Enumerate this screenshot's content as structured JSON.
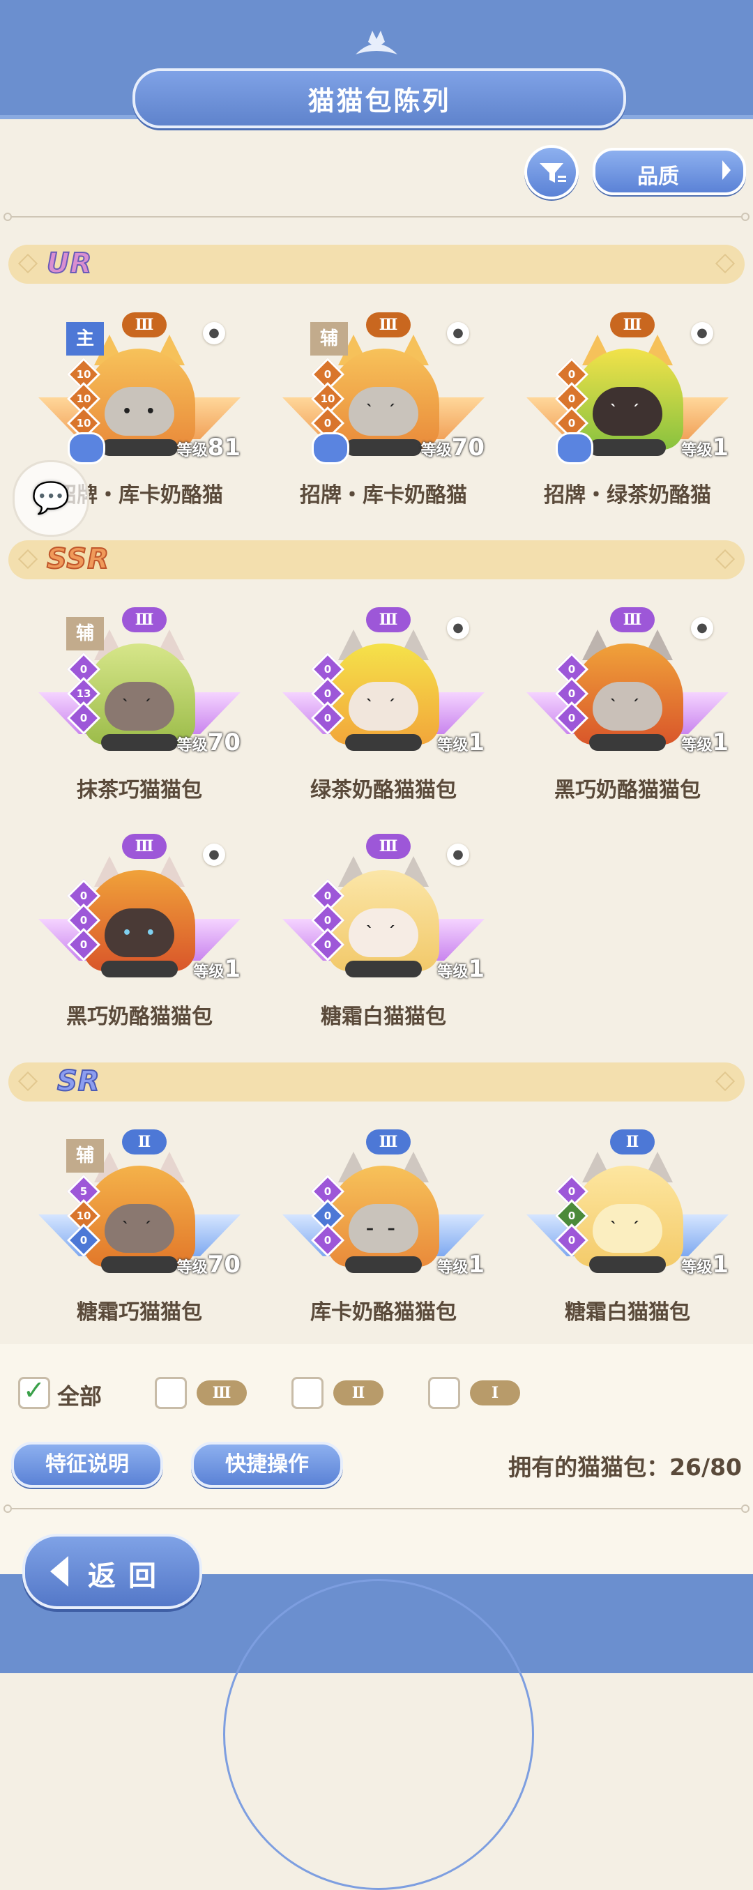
{
  "title": "猫猫包陈列",
  "filter_label": "",
  "quality_label": "品质",
  "sections": [
    {
      "tag": "UR",
      "cards": [
        {
          "role": "主",
          "grade": "Ⅲ",
          "stats": [
            "10",
            "10",
            "10"
          ],
          "level_label": "等级",
          "level": "81",
          "name": "招牌・库卡奶酪猫"
        },
        {
          "role": "辅",
          "grade": "Ⅲ",
          "stats": [
            "0",
            "10",
            "0"
          ],
          "level_label": "等级",
          "level": "70",
          "name": "招牌・库卡奶酪猫"
        },
        {
          "role": "",
          "grade": "Ⅲ",
          "stats": [
            "0",
            "0",
            "0"
          ],
          "level_label": "等级",
          "level": "1",
          "name": "招牌・绿茶奶酪猫"
        }
      ]
    },
    {
      "tag": "SSR",
      "cards": [
        {
          "role": "辅",
          "grade": "Ⅲ",
          "stats": [
            "0",
            "13",
            "0"
          ],
          "level_label": "等级",
          "level": "70",
          "name": "抹茶巧猫猫包"
        },
        {
          "role": "",
          "grade": "Ⅲ",
          "stats": [
            "0",
            "0",
            "0"
          ],
          "level_label": "等级",
          "level": "1",
          "name": "绿茶奶酪猫猫包"
        },
        {
          "role": "",
          "grade": "Ⅲ",
          "stats": [
            "0",
            "0",
            "0"
          ],
          "level_label": "等级",
          "level": "1",
          "name": "黑巧奶酪猫猫包"
        },
        {
          "role": "",
          "grade": "Ⅲ",
          "stats": [
            "0",
            "0",
            "0"
          ],
          "level_label": "等级",
          "level": "1",
          "name": "黑巧奶酪猫猫包"
        },
        {
          "role": "",
          "grade": "Ⅲ",
          "stats": [
            "0",
            "0",
            "0"
          ],
          "level_label": "等级",
          "level": "1",
          "name": "糖霜白猫猫包"
        }
      ]
    },
    {
      "tag": "SR",
      "cards": [
        {
          "role": "辅",
          "grade": "Ⅱ",
          "stats": [
            "5",
            "10",
            "0"
          ],
          "level_label": "等级",
          "level": "70",
          "name": "糖霜巧猫猫包"
        },
        {
          "role": "",
          "grade": "Ⅲ",
          "stats": [
            "0",
            "0",
            "0"
          ],
          "level_label": "等级",
          "level": "1",
          "name": "库卡奶酪猫猫包"
        },
        {
          "role": "",
          "grade": "Ⅱ",
          "stats": [
            "0",
            "0",
            "0"
          ],
          "level_label": "等级",
          "level": "1",
          "name": "糖霜白猫猫包"
        }
      ]
    }
  ],
  "filters": {
    "all_label": "全部",
    "all_checked": true,
    "grades": [
      "Ⅲ",
      "Ⅱ",
      "Ⅰ"
    ]
  },
  "buttons": {
    "feature": "特征说明",
    "quick": "快捷操作",
    "back": "返回"
  },
  "owned_text": "拥有的猫猫包：26/80",
  "chat_icon": "chat-bubble-icon"
}
